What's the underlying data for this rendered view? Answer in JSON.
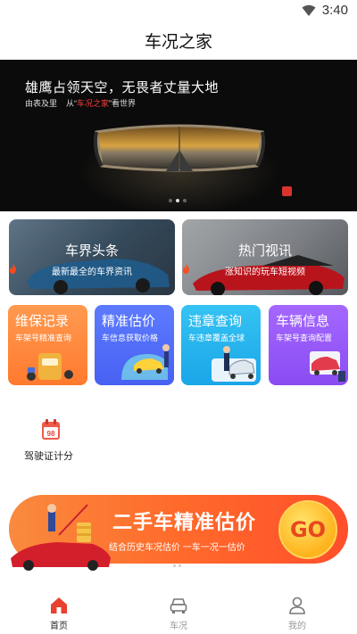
{
  "status_bar": {
    "time": "3:40"
  },
  "header": {
    "title": "车况之家"
  },
  "banner": {
    "headline": "雄鹰占领天空，无畏者丈量大地",
    "sub_prefix": "由表及里",
    "sub_middle": "从“",
    "sub_brand": "车况之家",
    "sub_suffix": "”看世界",
    "dots": 3,
    "active_dot": 1
  },
  "news_cards": [
    {
      "title": "车界头条",
      "subtitle": "最新最全的车界资讯"
    },
    {
      "title": "热门视讯",
      "subtitle": "涨知识的玩车短视频"
    }
  ],
  "feature_tiles": [
    {
      "title": "维保记录",
      "subtitle": "车架号精准查询"
    },
    {
      "title": "精准估价",
      "subtitle": "车信息获取价格"
    },
    {
      "title": "违章查询",
      "subtitle": "车违章覆盖全球"
    },
    {
      "title": "车辆信息",
      "subtitle": "车架号查询配置"
    }
  ],
  "license_points": {
    "icon_number": "98",
    "label": "驾驶证计分"
  },
  "promo": {
    "title": "二手车精准估价",
    "subtitle": "结合历史车况估价 一车一况一估价",
    "go_label": "GO"
  },
  "tabbar": [
    {
      "label": "首页",
      "icon": "home-icon",
      "active": true
    },
    {
      "label": "车况",
      "icon": "car-icon",
      "active": false
    },
    {
      "label": "我的",
      "icon": "person-icon",
      "active": false
    }
  ],
  "colors": {
    "accent_red": "#ff3b3b",
    "tile_maintenance": "#ff8a3c",
    "tile_valuation": "#4f6cf8",
    "tile_violation": "#27b5ee",
    "tile_vehicle": "#985af8",
    "promo_orange": "#ff6a2b",
    "tab_active": "#e8412f",
    "tab_inactive": "#999999"
  }
}
